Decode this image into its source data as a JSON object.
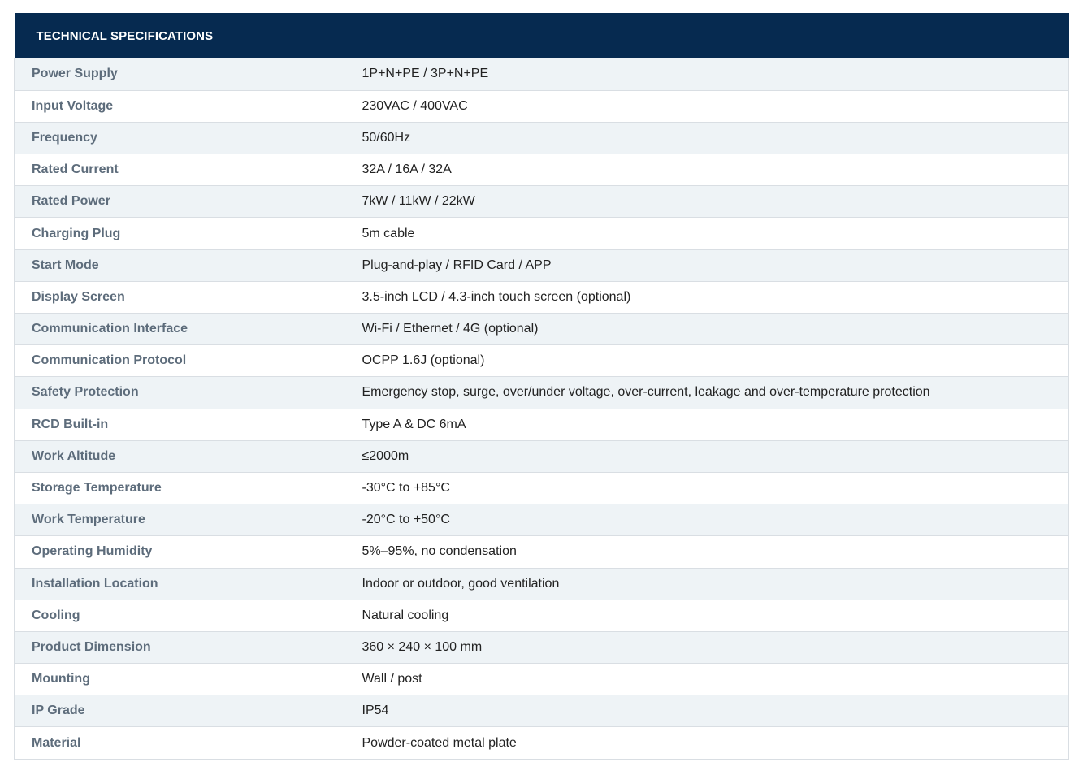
{
  "header": {
    "title": "TECHNICAL SPECIFICATIONS"
  },
  "colors": {
    "header_bg": "#062a50",
    "header_text": "#ffffff",
    "label_text": "#5d6c7b",
    "value_text": "#222222",
    "row_alt_bg": "#eef3f6",
    "border": "#d9dee3"
  },
  "specs": [
    {
      "label": "Power Supply",
      "value": "1P+N+PE / 3P+N+PE"
    },
    {
      "label": "Input Voltage",
      "value": "230VAC / 400VAC"
    },
    {
      "label": "Frequency",
      "value": "50/60Hz"
    },
    {
      "label": "Rated Current",
      "value": "32A / 16A / 32A"
    },
    {
      "label": "Rated Power",
      "value": "7kW / 11kW / 22kW"
    },
    {
      "label": "Charging Plug",
      "value": "5m cable"
    },
    {
      "label": "Start Mode",
      "value": "Plug-and-play / RFID Card / APP"
    },
    {
      "label": "Display Screen",
      "value": "3.5-inch LCD / 4.3-inch touch screen (optional)"
    },
    {
      "label": "Communication Interface",
      "value": "Wi-Fi / Ethernet / 4G (optional)"
    },
    {
      "label": "Communication Protocol",
      "value": "OCPP 1.6J (optional)"
    },
    {
      "label": "Safety Protection",
      "value": "Emergency stop, surge, over/under voltage, over-current, leakage and over-temperature protection"
    },
    {
      "label": "RCD Built-in",
      "value": "Type A & DC 6mA"
    },
    {
      "label": "Work Altitude",
      "value": "≤2000m"
    },
    {
      "label": "Storage Temperature",
      "value": "-30°C to +85°C"
    },
    {
      "label": "Work Temperature",
      "value": "-20°C to +50°C"
    },
    {
      "label": "Operating Humidity",
      "value": "5%–95%, no condensation"
    },
    {
      "label": "Installation Location",
      "value": "Indoor or outdoor, good ventilation"
    },
    {
      "label": "Cooling",
      "value": "Natural cooling"
    },
    {
      "label": "Product Dimension",
      "value": "360 × 240 × 100 mm"
    },
    {
      "label": "Mounting",
      "value": "Wall / post"
    },
    {
      "label": "IP Grade",
      "value": "IP54"
    },
    {
      "label": "Material",
      "value": "Powder-coated metal plate"
    }
  ]
}
